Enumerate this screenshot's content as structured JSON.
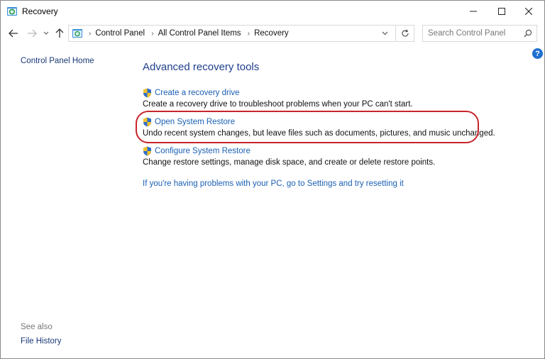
{
  "window": {
    "title": "Recovery"
  },
  "nav": {
    "breadcrumb": [
      "Control Panel",
      "All Control Panel Items",
      "Recovery"
    ],
    "search_placeholder": "Search Control Panel"
  },
  "sidebar": {
    "home_link": "Control Panel Home",
    "see_also_label": "See also",
    "file_history_link": "File History"
  },
  "main": {
    "heading": "Advanced recovery tools",
    "tools": [
      {
        "link": "Create a recovery drive",
        "description": "Create a recovery drive to troubleshoot problems when your PC can't start."
      },
      {
        "link": "Open System Restore",
        "description": "Undo recent system changes, but leave files such as documents, pictures, and music unchanged."
      },
      {
        "link": "Configure System Restore",
        "description": "Change restore settings, manage disk space, and create or delete restore points."
      }
    ],
    "reset_link": "If you're having problems with your PC, go to Settings and try resetting it"
  },
  "help": {
    "glyph": "?"
  },
  "colors": {
    "link": "#1a5fb4",
    "heading": "#1e3f8c",
    "highlight": "#c8242c"
  },
  "icons": [
    "recovery-app-icon",
    "back-arrow-icon",
    "forward-arrow-icon",
    "history-dropdown-icon",
    "up-arrow-icon",
    "control-panel-icon",
    "refresh-icon",
    "search-icon",
    "shield-icon",
    "help-icon"
  ]
}
